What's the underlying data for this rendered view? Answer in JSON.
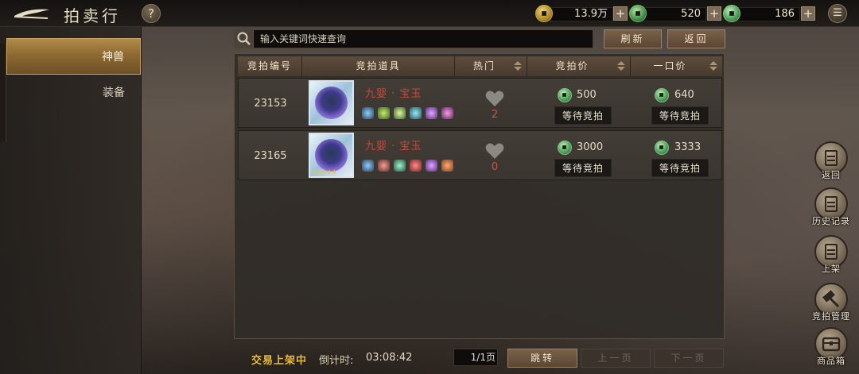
{
  "header": {
    "title": "拍卖行",
    "help_icon": "question-mark-icon",
    "currencies": [
      {
        "icon": "gold-coin-icon",
        "value": "13.9万"
      },
      {
        "icon": "green-coin-icon",
        "value": "520"
      },
      {
        "icon": "jade-coin-icon",
        "value": "186"
      }
    ],
    "menu_icon": "list-menu-icon"
  },
  "sidebar": {
    "tabs": [
      {
        "label": "神兽",
        "active": true
      },
      {
        "label": "装备",
        "active": false
      }
    ]
  },
  "search": {
    "placeholder": "输入关键词快速查询",
    "refresh_label": "刷新",
    "back_label": "返回"
  },
  "table": {
    "columns": [
      "竞拍编号",
      "竞拍道具",
      "热门",
      "竞拍价",
      "一口价"
    ],
    "rows": [
      {
        "id": "23153",
        "item_name": "九婴 · 宝玉",
        "stars": "",
        "hot": "2",
        "bid_price": "500",
        "bid_status": "等待竞拍",
        "buyout_price": "640",
        "buyout_status": "等待竞拍"
      },
      {
        "id": "23165",
        "item_name": "九婴 · 宝玉",
        "stars": "★★★★★",
        "hot": "0",
        "bid_price": "3000",
        "bid_status": "等待竞拍",
        "buyout_price": "3333",
        "buyout_status": "等待竞拍"
      }
    ]
  },
  "footer": {
    "status": "交易上架中",
    "countdown_label": "倒计时:",
    "countdown_value": "03:08:42",
    "page": "1/1页",
    "jump_label": "跳转",
    "prev_label": "上一页",
    "next_label": "下一页"
  },
  "side_menu": [
    {
      "label": "返回",
      "icon": "scroll-icon"
    },
    {
      "label": "历史记录",
      "icon": "scroll-icon"
    },
    {
      "label": "上架",
      "icon": "scroll-icon"
    },
    {
      "label": "竞拍管理",
      "icon": "gavel-icon"
    },
    {
      "label": "商品箱",
      "icon": "chest-icon"
    }
  ],
  "colors": {
    "accent_gold": "#b28a48",
    "hot_red": "#d4513f",
    "item_name_red": "#c44a3c",
    "status_gold": "#e6b93f"
  }
}
